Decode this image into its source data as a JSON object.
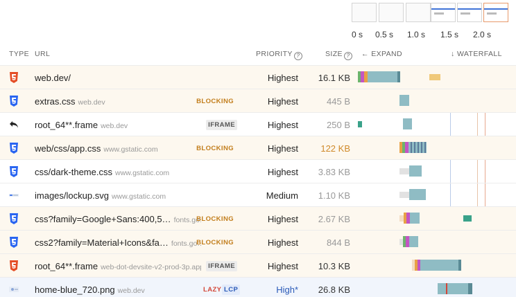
{
  "timeline": {
    "ticks": [
      "0 s",
      "0.5 s",
      "1.0 s",
      "1.5 s",
      "2.0 s"
    ]
  },
  "header": {
    "type": "TYPE",
    "url": "URL",
    "priority": "PRIORITY",
    "size": "SIZE",
    "expand": "← EXPAND",
    "waterfall": "↓ WATERFALL"
  },
  "colors": {
    "html": "#e44d26",
    "css": "#2965f1",
    "bar": "#8fbcc4",
    "bar_dark": "#5a8a95",
    "accent_orange": "#e89a6b",
    "highlight_blue": "#2a5ab8"
  },
  "rows": [
    {
      "icon": "html5-icon",
      "url": "web.dev/",
      "domain": "",
      "tag": "",
      "priority": "Highest",
      "size": "16.1 KB"
    },
    {
      "icon": "css3-icon",
      "url": "extras.css",
      "domain": "web.dev",
      "tag": "BLOCKING",
      "priority": "Highest",
      "size": "445 B"
    },
    {
      "icon": "redirect-arrow-icon",
      "url": "root_64**.frame",
      "domain": "web.dev",
      "tag": "IFRAME",
      "priority": "Highest",
      "size": "250 B"
    },
    {
      "icon": "css3-icon",
      "url": "web/css/app.css",
      "domain": "www.gstatic.com",
      "tag": "BLOCKING",
      "priority": "Highest",
      "size": "122 KB"
    },
    {
      "icon": "css3-icon",
      "url": "css/dark-theme.css",
      "domain": "www.gstatic.com",
      "tag": "",
      "priority": "Highest",
      "size": "3.83 KB"
    },
    {
      "icon": "svg-image-icon",
      "url": "images/lockup.svg",
      "domain": "www.gstatic.com",
      "tag": "",
      "priority": "Medium",
      "size": "1.10 KB"
    },
    {
      "icon": "css3-icon",
      "url": "css?family=Google+Sans:400,5…",
      "domain": "fonts.go…",
      "tag": "BLOCKING",
      "priority": "Highest",
      "size": "2.67 KB"
    },
    {
      "icon": "css3-icon",
      "url": "css2?family=Material+Icons&fa…",
      "domain": "fonts.go…",
      "tag": "BLOCKING",
      "priority": "Highest",
      "size": "844 B"
    },
    {
      "icon": "html5-icon",
      "url": "root_64**.frame",
      "domain": "web-dot-devsite-v2-prod-3p.appsp…",
      "tag": "IFRAME",
      "priority": "Highest",
      "size": "10.3 KB"
    },
    {
      "icon": "png-image-icon",
      "url": "home-blue_720.png",
      "domain": "web.dev",
      "tag": "",
      "lazy": "LAZY",
      "lcp": "LCP",
      "priority": "High*",
      "size": "26.8 KB"
    }
  ]
}
